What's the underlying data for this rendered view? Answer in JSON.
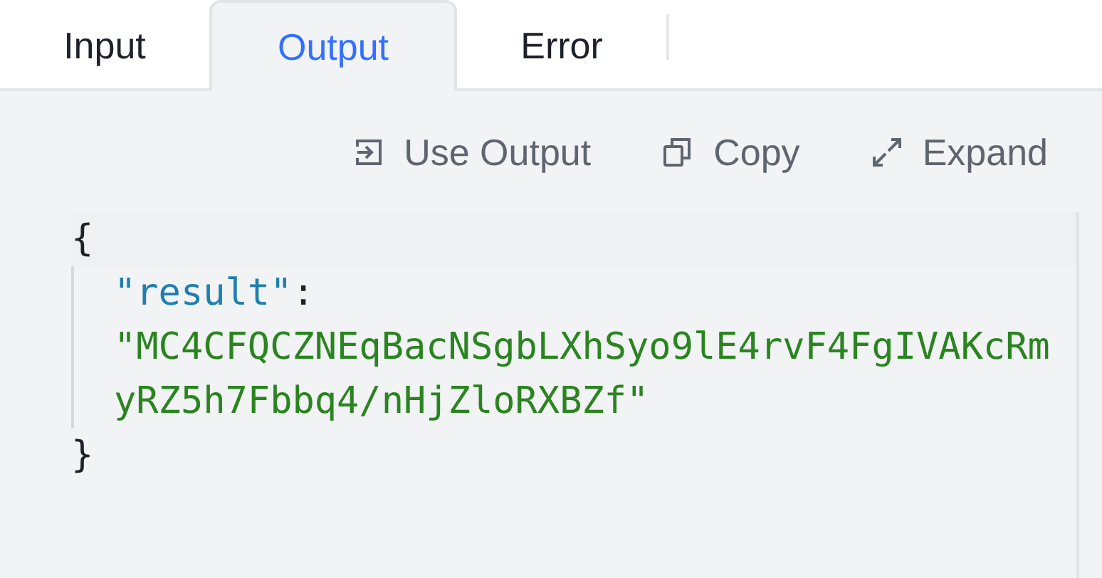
{
  "tabs": [
    {
      "label": "Input",
      "selected": false
    },
    {
      "label": "Output",
      "selected": true
    },
    {
      "label": "Error",
      "selected": false
    }
  ],
  "actions": [
    {
      "kind": "use",
      "label": "Use Output"
    },
    {
      "kind": "copy",
      "label": "Copy"
    },
    {
      "kind": "expand",
      "label": "Expand"
    }
  ],
  "code": {
    "open": "{",
    "key": "\"result\"",
    "colon": ":",
    "value": "\"MC4CFQCZNEqBacNSgbLXhSyo9lE4rvF4FgIVAKcRmyRZ5h7Fbbq4/nHjZloRXBZf\"",
    "close": "}"
  }
}
